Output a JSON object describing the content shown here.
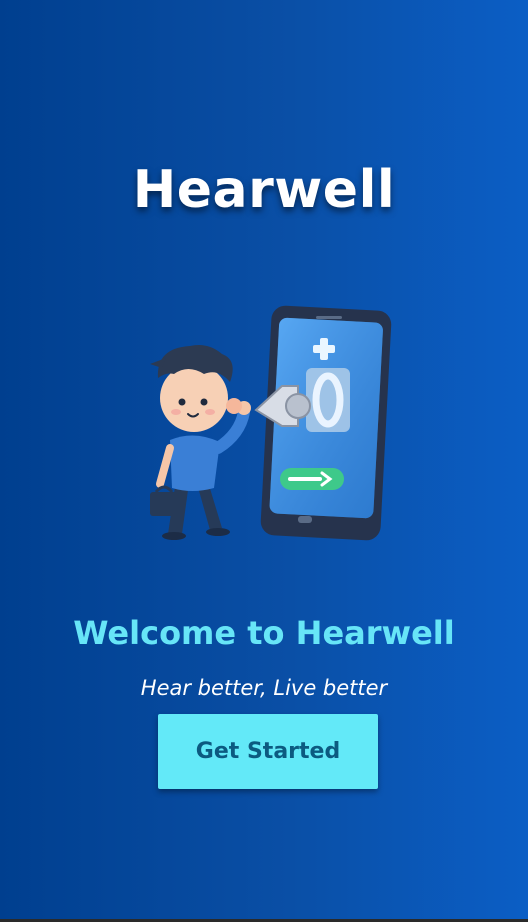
{
  "app": {
    "title": "Hearwell"
  },
  "hero": {
    "illustration": "boy-listening-to-phone-illustration"
  },
  "welcome": {
    "heading": "Welcome to Hearwell",
    "tagline": "Hear better, Live better"
  },
  "actions": {
    "get_started_label": "Get Started"
  },
  "colors": {
    "background_start": "#003f8f",
    "background_end": "#0b5ec5",
    "accent": "#63e9f8",
    "button_text": "#0c5a80",
    "title": "#ffffff"
  }
}
